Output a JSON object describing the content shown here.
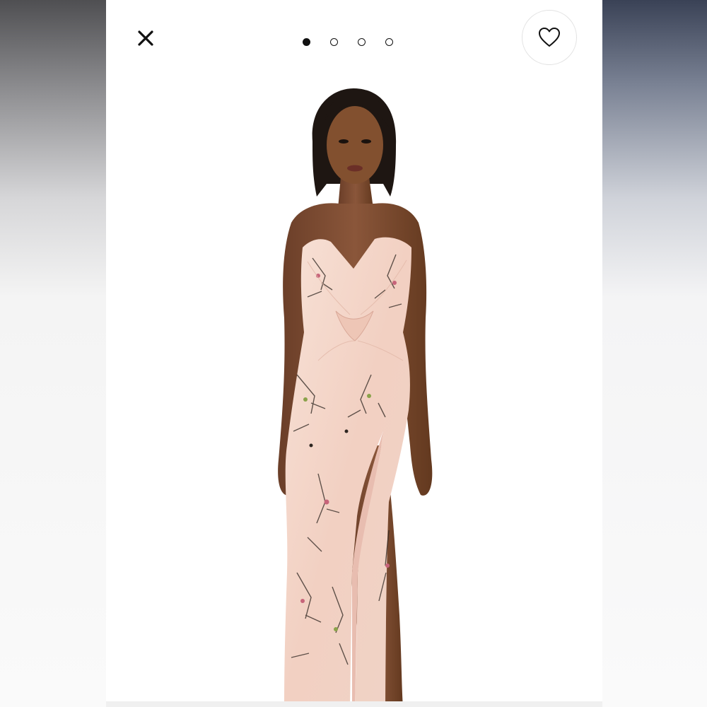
{
  "toolbar": {
    "close_icon": "close-icon",
    "favorite_icon": "heart-outline-icon"
  },
  "carousel": {
    "total": 4,
    "active_index": 0
  },
  "product": {
    "image_alt": "model-in-strapless-floral-satin-gown",
    "colors": {
      "dress_base": "#f4d9cd",
      "skin": "#7a4a30",
      "hair": "#1e1612",
      "print_dark": "#2d2520",
      "print_accent": "#c7647a"
    }
  }
}
